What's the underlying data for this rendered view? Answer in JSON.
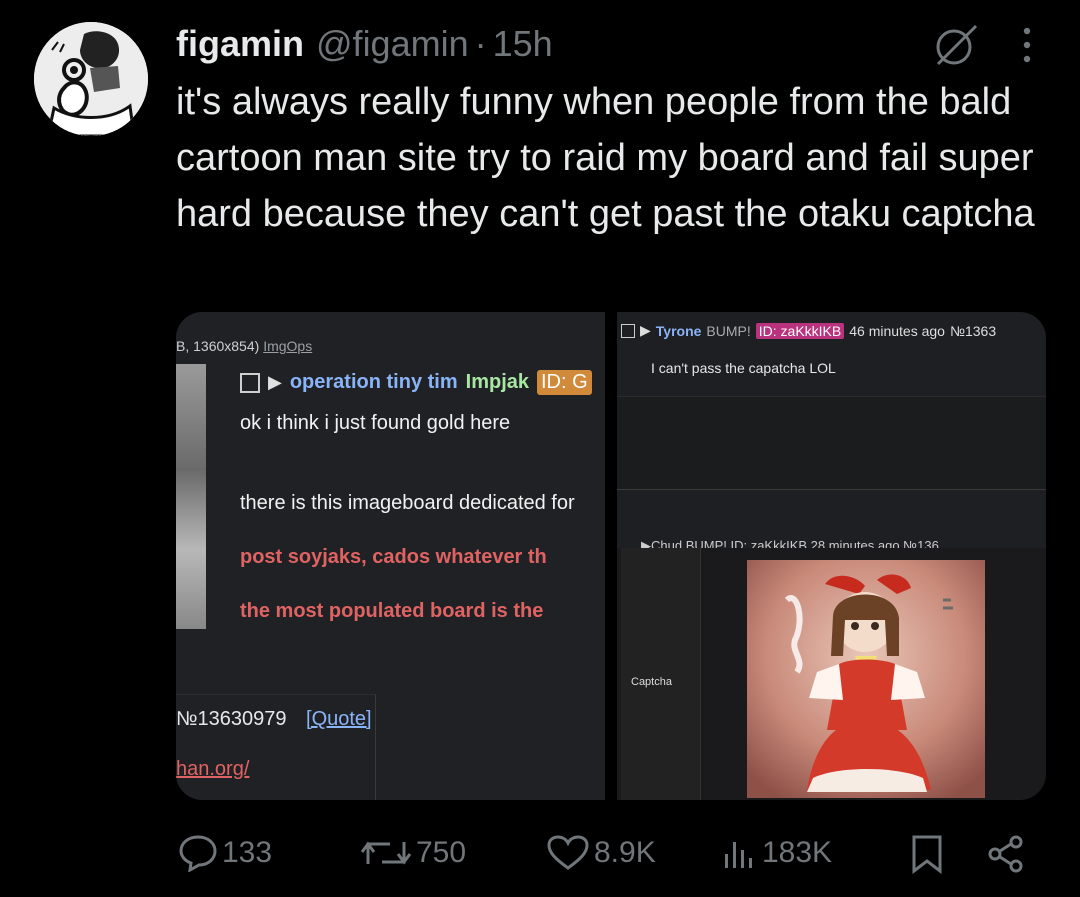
{
  "tweet": {
    "author_name": "figamin",
    "author_handle": "@figamin",
    "separator": "·",
    "time_ago": "15h",
    "text": "it's always really funny when people from the bald cartoon man site try to raid my board and fail super hard because they can't get past the otaku captcha"
  },
  "media": {
    "left": {
      "meta_prefix": "B, 1360x854)",
      "meta_link": "ImgOps",
      "subject": "operation tiny tim",
      "poster": "Impjak",
      "id_badge": "ID: G",
      "line1": "ok i think i just found gold here",
      "line2": "there is this imageboard dedicated for",
      "red1": "post soyjaks, cados whatever th",
      "red2": "the most populated board is the",
      "post_number": "№13630979",
      "quote_label": "[Quote]",
      "link": "han.org/"
    },
    "top_right": {
      "name": "Tyrone",
      "bump": "BUMP!",
      "id": "ID: zaKkkIKB",
      "time": "46 minutes ago",
      "number": "№1363",
      "text": "I can't pass the capatcha LOL",
      "second_header": "▶Chud BUMP! ID: zaKkkIKB 28 minutes ago №136"
    },
    "bottom_right": {
      "captcha_label": "Captcha"
    }
  },
  "actions": {
    "replies": "133",
    "reposts": "750",
    "likes": "8.9K",
    "views": "183K"
  },
  "colors": {
    "background": "#000000",
    "text": "#e7e9ea",
    "muted": "#71767b"
  }
}
